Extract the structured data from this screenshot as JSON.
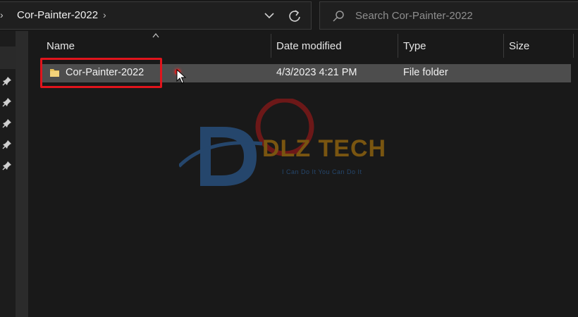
{
  "address_bar": {
    "breadcrumb": "Cor-Painter-2022"
  },
  "search": {
    "placeholder": "Search Cor-Painter-2022"
  },
  "columns": {
    "name": "Name",
    "date_modified": "Date modified",
    "type": "Type",
    "size": "Size"
  },
  "files": [
    {
      "name": "Cor-Painter-2022",
      "date_modified": "4/3/2023 4:21 PM",
      "type": "File folder",
      "size": ""
    }
  ],
  "watermark": {
    "brand": "DLZ TECH",
    "slogan": "I Can Do It You Can Do It"
  },
  "colors": {
    "highlight": "#e0141c",
    "folder": "#e8c15a",
    "selected_row": "#4d4d4d",
    "watermark_text": "#c8860a"
  },
  "icons": {
    "nav_left": "chevron-right-icon",
    "breadcrumb_sep": "chevron-right-icon",
    "dropdown": "chevron-down-icon",
    "refresh": "refresh-icon",
    "search": "search-icon",
    "pin": "pin-icon",
    "folder": "folder-icon",
    "cursor": "mouse-cursor-icon"
  }
}
